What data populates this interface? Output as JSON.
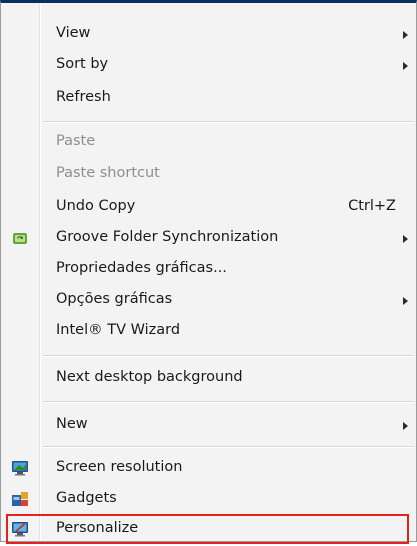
{
  "menu": {
    "items": [
      {
        "id": "view",
        "label": "View",
        "submenu": true
      },
      {
        "id": "sort-by",
        "label": "Sort by",
        "submenu": true
      },
      {
        "id": "refresh",
        "label": "Refresh"
      },
      {
        "id": "paste",
        "label": "Paste",
        "disabled": true
      },
      {
        "id": "paste-shortcut",
        "label": "Paste shortcut",
        "disabled": true
      },
      {
        "id": "undo-copy",
        "label": "Undo Copy",
        "shortcut": "Ctrl+Z"
      },
      {
        "id": "groove",
        "label": "Groove Folder Synchronization",
        "submenu": true,
        "icon": "groove-sync-icon"
      },
      {
        "id": "propriedades",
        "label": "Propriedades gráficas..."
      },
      {
        "id": "opcoes",
        "label": "Opções gráficas",
        "submenu": true
      },
      {
        "id": "intel-tv",
        "label": "Intel® TV Wizard"
      },
      {
        "id": "next-bg",
        "label": "Next desktop background"
      },
      {
        "id": "new",
        "label": "New",
        "submenu": true
      },
      {
        "id": "screen-resolution",
        "label": "Screen resolution",
        "icon": "monitor-icon"
      },
      {
        "id": "gadgets",
        "label": "Gadgets",
        "icon": "gadgets-icon"
      },
      {
        "id": "personalize",
        "label": "Personalize",
        "icon": "personalize-icon",
        "highlighted": true
      }
    ]
  },
  "colors": {
    "highlight_border": "#e0241b",
    "top_bar": "#0b2f63",
    "menu_bg": "#f3f3f3"
  }
}
